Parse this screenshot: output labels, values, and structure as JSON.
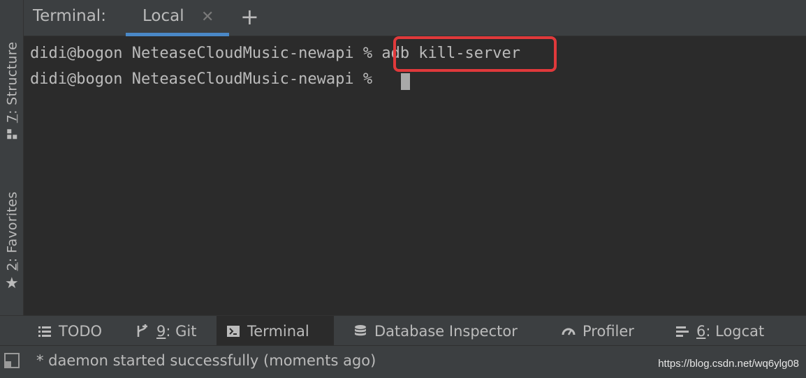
{
  "sidebar": {
    "structure": {
      "number": "7",
      "label": ": Structure",
      "icon": "structure-icon"
    },
    "favorites": {
      "number": "2",
      "label": ": Favorites",
      "icon": "star-icon"
    }
  },
  "terminal_header": {
    "title": "Terminal:",
    "tabs": [
      {
        "label": "Local",
        "close_icon": "close-icon",
        "active": true
      }
    ],
    "add_icon": "plus-icon"
  },
  "terminal": {
    "lines": [
      {
        "prompt": "didi@bogon NeteaseCloudMusic-newapi % ",
        "command": "adb kill-server"
      },
      {
        "prompt": "didi@bogon NeteaseCloudMusic-newapi % ",
        "command": ""
      }
    ],
    "highlight_color": "#e0393b"
  },
  "tool_windows": [
    {
      "key": "",
      "label": "TODO",
      "icon": "list-icon"
    },
    {
      "key": "9",
      "label": ": Git",
      "icon": "git-branch-icon"
    },
    {
      "key": "",
      "label": "Terminal",
      "icon": "terminal-icon",
      "active": true
    },
    {
      "key": "",
      "label": "Database Inspector",
      "icon": "database-icon"
    },
    {
      "key": "",
      "label": "Profiler",
      "icon": "gauge-icon"
    },
    {
      "key": "6",
      "label": ": Logcat",
      "icon": "logcat-icon"
    }
  ],
  "status_bar": {
    "message": "* daemon started successfully (moments ago)",
    "watermark": "https://blog.csdn.net/wq6ylg08"
  },
  "colors": {
    "accent": "#4a88c7",
    "background": "#2b2b2b",
    "panel": "#3c3f41",
    "text": "#bbbbbb"
  }
}
